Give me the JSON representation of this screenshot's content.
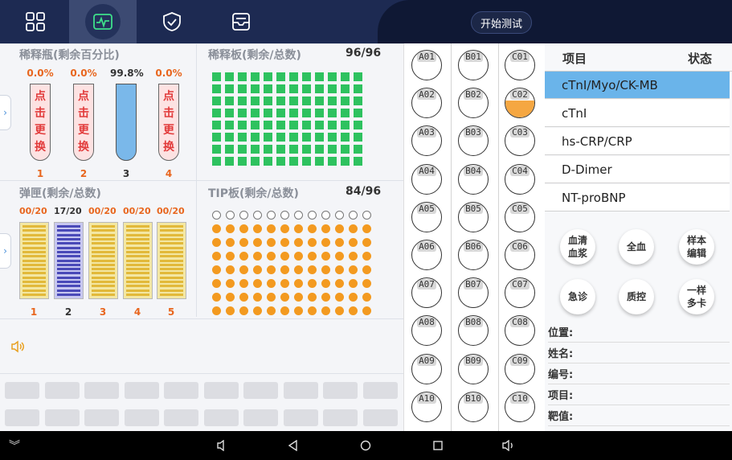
{
  "toolbar": {
    "start_label": "开始测试",
    "icons": [
      "grid-icon",
      "heartbeat-icon",
      "shield-check-icon",
      "inbox-icon"
    ]
  },
  "diluent": {
    "title": "稀释瓶(剩余百分比)",
    "bottles": [
      {
        "pct": "0.0%",
        "index": "1",
        "empty": true,
        "chars": [
          "点",
          "击",
          "更",
          "换"
        ]
      },
      {
        "pct": "0.0%",
        "index": "2",
        "empty": true,
        "chars": [
          "点",
          "击",
          "更",
          "换"
        ]
      },
      {
        "pct": "99.8%",
        "index": "3",
        "empty": false,
        "chars": []
      },
      {
        "pct": "0.0%",
        "index": "4",
        "empty": true,
        "chars": [
          "点",
          "击",
          "更",
          "换"
        ]
      }
    ]
  },
  "dilution_plate": {
    "title": "稀释板(剩余/总数)",
    "count": "96/96",
    "remaining": 96,
    "total": 96
  },
  "cartridge": {
    "title": "弹匣(剩余/总数)",
    "slots": [
      {
        "count": "00/20",
        "index": "1",
        "active": false
      },
      {
        "count": "17/20",
        "index": "2",
        "active": true
      },
      {
        "count": "00/20",
        "index": "3",
        "active": false
      },
      {
        "count": "00/20",
        "index": "4",
        "active": false
      },
      {
        "count": "00/20",
        "index": "5",
        "active": false
      }
    ]
  },
  "tip_plate": {
    "title": "TIP板(剩余/总数)",
    "count": "84/96",
    "remaining": 84,
    "total": 96
  },
  "racks": {
    "columns": [
      [
        "A01",
        "A02",
        "A03",
        "A04",
        "A05",
        "A06",
        "A07",
        "A08",
        "A09",
        "A10"
      ],
      [
        "B01",
        "B02",
        "B03",
        "B04",
        "B05",
        "B06",
        "B07",
        "B08",
        "B09",
        "B10"
      ],
      [
        "C01",
        "C02",
        "C03",
        "C04",
        "C05",
        "C06",
        "C07",
        "C08",
        "C09",
        "C10"
      ]
    ],
    "filled": [
      "C02"
    ]
  },
  "projects": {
    "header_item": "项目",
    "header_status": "状态",
    "items": [
      "cTnI/Myo/CK-MB",
      "cTnI",
      "hs-CRP/CRP",
      "D-Dimer",
      "NT-proBNP"
    ],
    "selected": 0
  },
  "sample_buttons": {
    "serum": "血清\n血浆",
    "whole_blood": "全血",
    "sample_edit": "样本\n编辑",
    "emergency": "急诊",
    "qc": "质控",
    "multi_card": "一样\n多卡"
  },
  "info": {
    "position": "位置:",
    "name": "姓名:",
    "number": "编号:",
    "project": "项目:",
    "target": "靶值:"
  }
}
